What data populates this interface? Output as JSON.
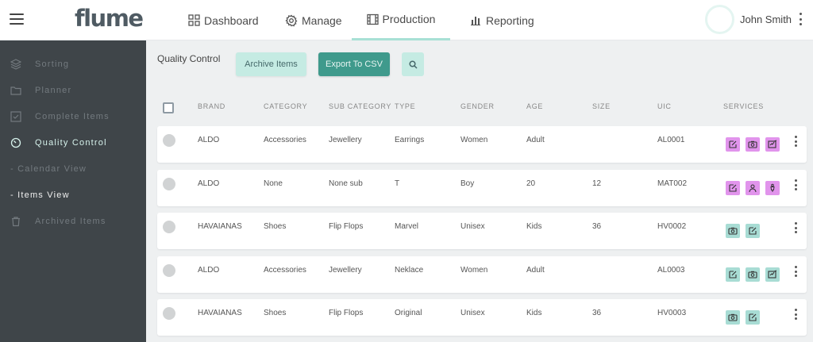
{
  "brand": {
    "logo_text": "flume"
  },
  "nav": {
    "dashboard": "Dashboard",
    "manage": "Manage",
    "production": "Production",
    "reporting": "Reporting"
  },
  "user": {
    "name": "John Smith"
  },
  "sidebar": {
    "items": [
      {
        "label": "Sorting"
      },
      {
        "label": "Planner"
      },
      {
        "label": "Complete Items"
      },
      {
        "label": "Quality Control"
      },
      {
        "label": "- Calendar View"
      },
      {
        "label": "- Items View"
      },
      {
        "label": "Archived Items"
      }
    ]
  },
  "page": {
    "title": "Quality Control",
    "archive_label": "Archive Items",
    "export_label": "Export To CSV"
  },
  "table": {
    "headers": [
      "BRAND",
      "CATEGORY",
      "SUB CATEGORY",
      "TYPE",
      "GENDER",
      "AGE",
      "SIZE",
      "UIC",
      "SERVICES"
    ],
    "rows": [
      {
        "brand": "ALDO",
        "category": "Accessories",
        "sub_category": "Jewellery",
        "type": "Earrings",
        "gender": "Women",
        "age": "Adult",
        "size": "",
        "uic": "AL0001",
        "services": [
          {
            "icon": "edit-icon",
            "color": "purple"
          },
          {
            "icon": "camera-icon",
            "color": "purple"
          },
          {
            "icon": "signature-icon",
            "color": "purple"
          }
        ]
      },
      {
        "brand": "ALDO",
        "category": "None",
        "sub_category": "None sub",
        "type": "T",
        "gender": "Boy",
        "age": "20",
        "size": "12",
        "uic": "MAT002",
        "services": [
          {
            "icon": "edit-icon",
            "color": "purple"
          },
          {
            "icon": "person-icon",
            "color": "purple"
          },
          {
            "icon": "mannequin-icon",
            "color": "purple"
          }
        ]
      },
      {
        "brand": "HAVAIANAS",
        "category": "Shoes",
        "sub_category": "Flip Flops",
        "type": "Marvel",
        "gender": "Unisex",
        "age": "Kids",
        "size": "36",
        "uic": "HV0002",
        "services": [
          {
            "icon": "camera-icon",
            "color": "teal"
          },
          {
            "icon": "edit-icon",
            "color": "teal"
          }
        ]
      },
      {
        "brand": "ALDO",
        "category": "Accessories",
        "sub_category": "Jewellery",
        "type": "Neklace",
        "gender": "Women",
        "age": "Adult",
        "size": "",
        "uic": "AL0003",
        "services": [
          {
            "icon": "edit-icon",
            "color": "teal"
          },
          {
            "icon": "camera-icon",
            "color": "teal"
          },
          {
            "icon": "signature-icon",
            "color": "teal"
          }
        ]
      },
      {
        "brand": "HAVAIANAS",
        "category": "Shoes",
        "sub_category": "Flip Flops",
        "type": "Original",
        "gender": "Unisex",
        "age": "Kids",
        "size": "36",
        "uic": "HV0003",
        "services": [
          {
            "icon": "camera-icon",
            "color": "teal"
          },
          {
            "icon": "edit-icon",
            "color": "teal"
          }
        ]
      }
    ]
  },
  "colors": {
    "accent": "#3f9a8c",
    "accent_light": "#c5ebe3",
    "sidebar": "#3f4549",
    "service_purple": "#e194ec",
    "service_teal": "#a8dcd4"
  }
}
